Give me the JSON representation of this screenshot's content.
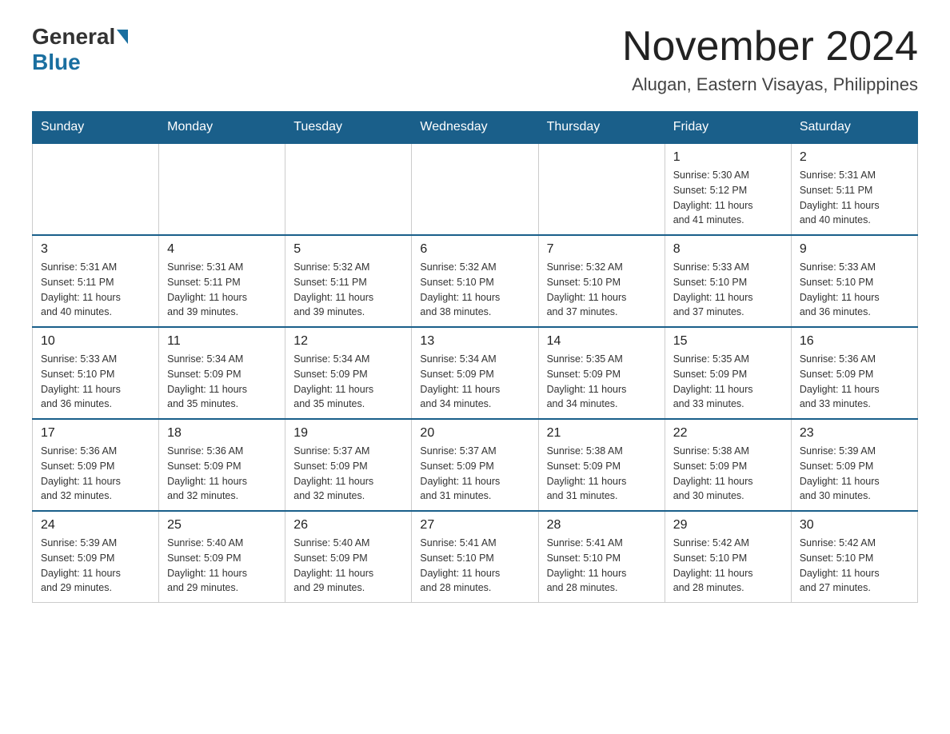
{
  "header": {
    "logo_general": "General",
    "logo_blue": "Blue",
    "month_title": "November 2024",
    "location": "Alugan, Eastern Visayas, Philippines"
  },
  "weekdays": [
    "Sunday",
    "Monday",
    "Tuesday",
    "Wednesday",
    "Thursday",
    "Friday",
    "Saturday"
  ],
  "weeks": [
    [
      {
        "day": "",
        "info": ""
      },
      {
        "day": "",
        "info": ""
      },
      {
        "day": "",
        "info": ""
      },
      {
        "day": "",
        "info": ""
      },
      {
        "day": "",
        "info": ""
      },
      {
        "day": "1",
        "info": "Sunrise: 5:30 AM\nSunset: 5:12 PM\nDaylight: 11 hours\nand 41 minutes."
      },
      {
        "day": "2",
        "info": "Sunrise: 5:31 AM\nSunset: 5:11 PM\nDaylight: 11 hours\nand 40 minutes."
      }
    ],
    [
      {
        "day": "3",
        "info": "Sunrise: 5:31 AM\nSunset: 5:11 PM\nDaylight: 11 hours\nand 40 minutes."
      },
      {
        "day": "4",
        "info": "Sunrise: 5:31 AM\nSunset: 5:11 PM\nDaylight: 11 hours\nand 39 minutes."
      },
      {
        "day": "5",
        "info": "Sunrise: 5:32 AM\nSunset: 5:11 PM\nDaylight: 11 hours\nand 39 minutes."
      },
      {
        "day": "6",
        "info": "Sunrise: 5:32 AM\nSunset: 5:10 PM\nDaylight: 11 hours\nand 38 minutes."
      },
      {
        "day": "7",
        "info": "Sunrise: 5:32 AM\nSunset: 5:10 PM\nDaylight: 11 hours\nand 37 minutes."
      },
      {
        "day": "8",
        "info": "Sunrise: 5:33 AM\nSunset: 5:10 PM\nDaylight: 11 hours\nand 37 minutes."
      },
      {
        "day": "9",
        "info": "Sunrise: 5:33 AM\nSunset: 5:10 PM\nDaylight: 11 hours\nand 36 minutes."
      }
    ],
    [
      {
        "day": "10",
        "info": "Sunrise: 5:33 AM\nSunset: 5:10 PM\nDaylight: 11 hours\nand 36 minutes."
      },
      {
        "day": "11",
        "info": "Sunrise: 5:34 AM\nSunset: 5:09 PM\nDaylight: 11 hours\nand 35 minutes."
      },
      {
        "day": "12",
        "info": "Sunrise: 5:34 AM\nSunset: 5:09 PM\nDaylight: 11 hours\nand 35 minutes."
      },
      {
        "day": "13",
        "info": "Sunrise: 5:34 AM\nSunset: 5:09 PM\nDaylight: 11 hours\nand 34 minutes."
      },
      {
        "day": "14",
        "info": "Sunrise: 5:35 AM\nSunset: 5:09 PM\nDaylight: 11 hours\nand 34 minutes."
      },
      {
        "day": "15",
        "info": "Sunrise: 5:35 AM\nSunset: 5:09 PM\nDaylight: 11 hours\nand 33 minutes."
      },
      {
        "day": "16",
        "info": "Sunrise: 5:36 AM\nSunset: 5:09 PM\nDaylight: 11 hours\nand 33 minutes."
      }
    ],
    [
      {
        "day": "17",
        "info": "Sunrise: 5:36 AM\nSunset: 5:09 PM\nDaylight: 11 hours\nand 32 minutes."
      },
      {
        "day": "18",
        "info": "Sunrise: 5:36 AM\nSunset: 5:09 PM\nDaylight: 11 hours\nand 32 minutes."
      },
      {
        "day": "19",
        "info": "Sunrise: 5:37 AM\nSunset: 5:09 PM\nDaylight: 11 hours\nand 32 minutes."
      },
      {
        "day": "20",
        "info": "Sunrise: 5:37 AM\nSunset: 5:09 PM\nDaylight: 11 hours\nand 31 minutes."
      },
      {
        "day": "21",
        "info": "Sunrise: 5:38 AM\nSunset: 5:09 PM\nDaylight: 11 hours\nand 31 minutes."
      },
      {
        "day": "22",
        "info": "Sunrise: 5:38 AM\nSunset: 5:09 PM\nDaylight: 11 hours\nand 30 minutes."
      },
      {
        "day": "23",
        "info": "Sunrise: 5:39 AM\nSunset: 5:09 PM\nDaylight: 11 hours\nand 30 minutes."
      }
    ],
    [
      {
        "day": "24",
        "info": "Sunrise: 5:39 AM\nSunset: 5:09 PM\nDaylight: 11 hours\nand 29 minutes."
      },
      {
        "day": "25",
        "info": "Sunrise: 5:40 AM\nSunset: 5:09 PM\nDaylight: 11 hours\nand 29 minutes."
      },
      {
        "day": "26",
        "info": "Sunrise: 5:40 AM\nSunset: 5:09 PM\nDaylight: 11 hours\nand 29 minutes."
      },
      {
        "day": "27",
        "info": "Sunrise: 5:41 AM\nSunset: 5:10 PM\nDaylight: 11 hours\nand 28 minutes."
      },
      {
        "day": "28",
        "info": "Sunrise: 5:41 AM\nSunset: 5:10 PM\nDaylight: 11 hours\nand 28 minutes."
      },
      {
        "day": "29",
        "info": "Sunrise: 5:42 AM\nSunset: 5:10 PM\nDaylight: 11 hours\nand 28 minutes."
      },
      {
        "day": "30",
        "info": "Sunrise: 5:42 AM\nSunset: 5:10 PM\nDaylight: 11 hours\nand 27 minutes."
      }
    ]
  ]
}
